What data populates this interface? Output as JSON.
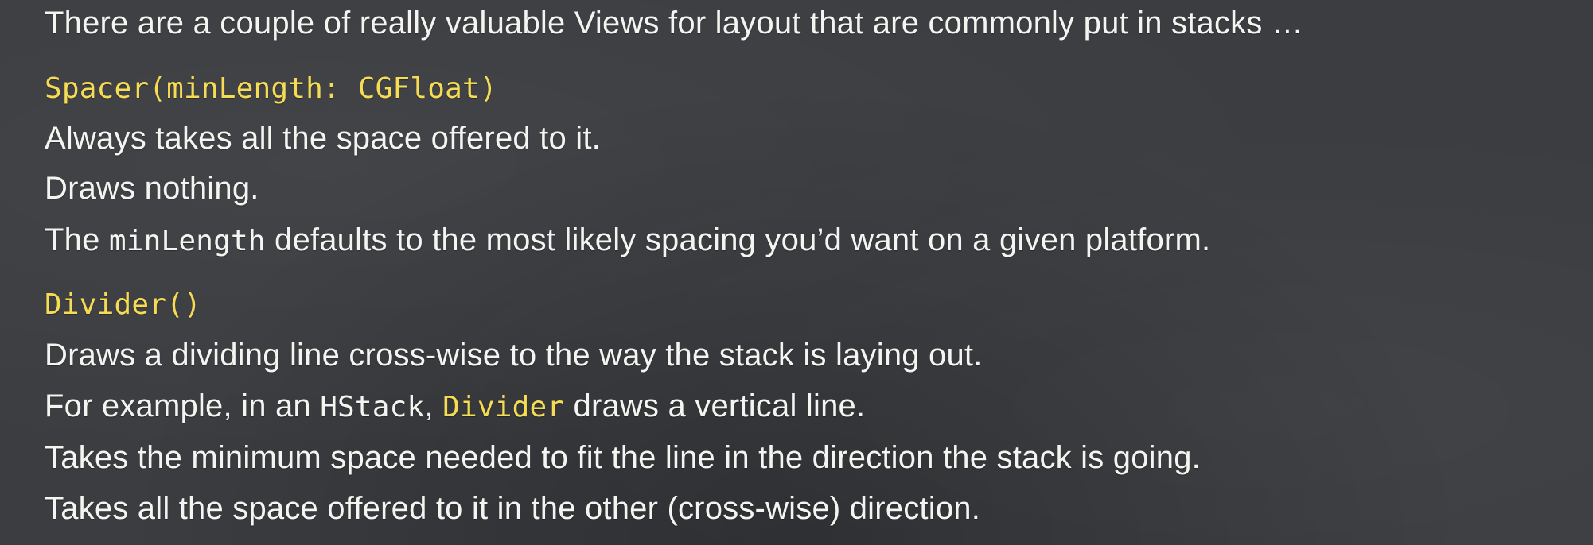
{
  "slide": {
    "intro": "There are a couple of really valuable Views for layout that are commonly put in stacks …",
    "spacer": {
      "signature": "Spacer(minLength: CGFloat)",
      "line1": "Always takes all the space offered to it.",
      "line2": "Draws nothing.",
      "line3_pre": "The ",
      "line3_code": "minLength",
      "line3_post": " defaults to the most likely spacing you’d want on a given platform."
    },
    "divider": {
      "signature": "Divider()",
      "line1": "Draws a dividing line cross-wise to the way the stack is laying out.",
      "line2_pre": "For example, in an ",
      "line2_code1": "HStack",
      "line2_mid": ", ",
      "line2_code2": "Divider",
      "line2_post": " draws a vertical line.",
      "line3": "Takes the minimum space needed to fit the line in the direction the stack is going.",
      "line4": "Takes all the space offered to it in the other (cross-wise) direction."
    },
    "colors": {
      "background": "#3b3d41",
      "text": "#f4f4f0",
      "code_highlight": "#f6dc54"
    }
  }
}
